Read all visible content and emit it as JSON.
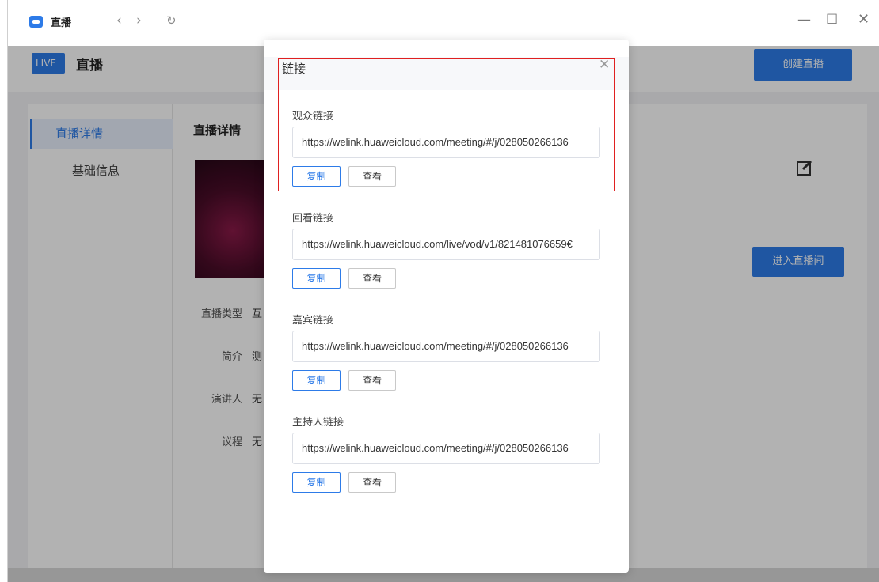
{
  "window": {
    "title": "直播",
    "nav": {
      "back": "‹",
      "forward": "›",
      "refresh": "↻"
    },
    "controls": {
      "minimize": "—",
      "maximize": "☐",
      "close": "✕"
    }
  },
  "app": {
    "badge": "LIVE",
    "title": "直播",
    "create_button": "创建直播",
    "sidebar": [
      {
        "label": "直播详情",
        "active": true
      },
      {
        "label": "基础信息",
        "active": false
      }
    ],
    "detail_title": "直播详情",
    "enter_button": "进入直播间",
    "info": [
      {
        "label": "直播类型",
        "value": "互"
      },
      {
        "label": "简介",
        "value": "测"
      },
      {
        "label": "演讲人",
        "value": "无"
      },
      {
        "label": "议程",
        "value": "无"
      }
    ]
  },
  "modal": {
    "title": "链接",
    "close": "✕",
    "sections": [
      {
        "label": "观众链接",
        "url": "https://welink.huaweicloud.com/meeting/#/j/028050266136",
        "copy": "复制",
        "view": "查看"
      },
      {
        "label": "回看链接",
        "url": "https://welink.huaweicloud.com/live/vod/v1/821481076659€",
        "copy": "复制",
        "view": "查看"
      },
      {
        "label": "嘉宾链接",
        "url": "https://welink.huaweicloud.com/meeting/#/j/028050266136",
        "copy": "复制",
        "view": "查看"
      },
      {
        "label": "主持人链接",
        "url": "https://welink.huaweicloud.com/meeting/#/j/028050266136",
        "copy": "复制",
        "view": "查看"
      }
    ]
  },
  "colors": {
    "accent": "#2d7be8",
    "highlight": "#e02020"
  }
}
